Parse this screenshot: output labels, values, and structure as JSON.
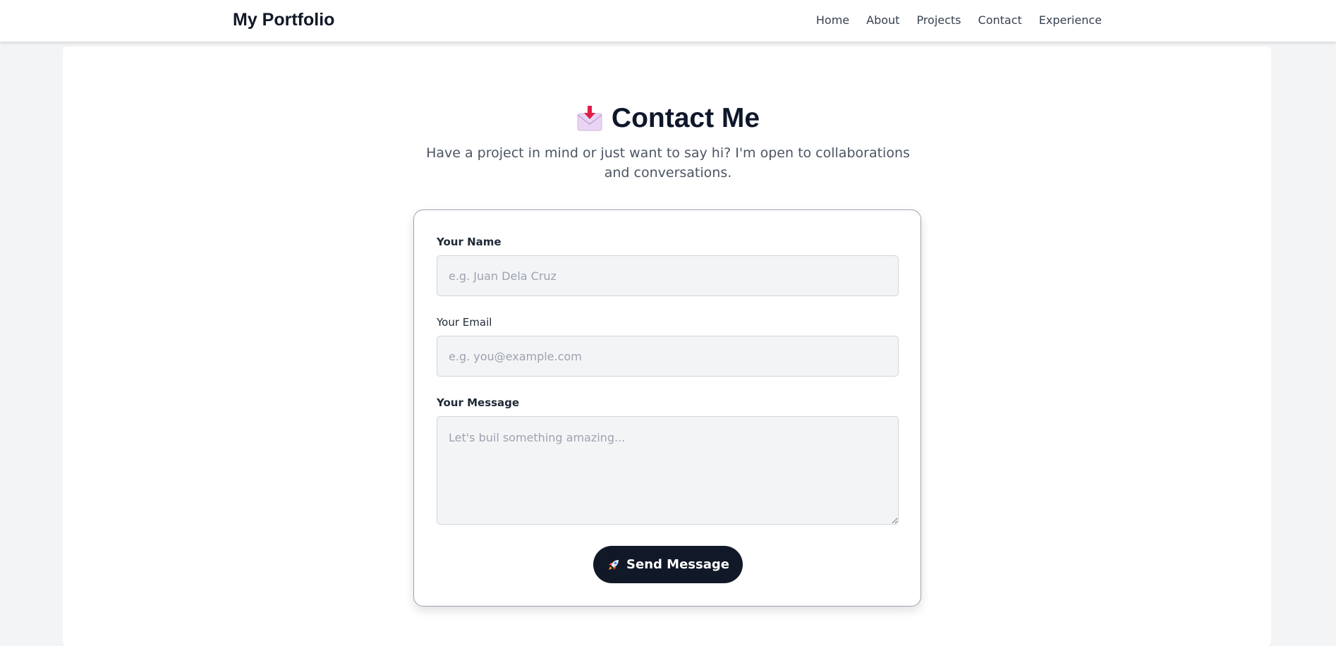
{
  "navbar": {
    "brand": "My Portfolio",
    "links": [
      "Home",
      "About",
      "Projects",
      "Contact",
      "Experience"
    ]
  },
  "hero": {
    "icon": "incoming-envelope-icon",
    "title": "Contact Me",
    "subtitle": "Have a project in mind or just want to say hi? I'm open to collaborations and conversations."
  },
  "form": {
    "name_label": "Your Name",
    "name_placeholder": "e.g. Juan Dela Cruz",
    "email_label": "Your Email",
    "email_placeholder": "e.g. you@example.com",
    "message_label": "Your Message",
    "message_placeholder": "Let's buil something amazing...",
    "submit_icon": "rocket-icon",
    "submit_label": "Send Message"
  },
  "colors": {
    "page_bg": "#f3f4f6",
    "button_bg": "#111827",
    "title": "#0f172a"
  }
}
